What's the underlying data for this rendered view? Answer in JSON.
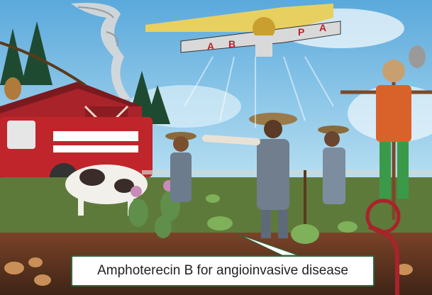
{
  "caption": {
    "text": "Amphoterecin B for angioinvasive disease"
  },
  "plane": {
    "wing_letters_left": [
      "A",
      "B"
    ],
    "wing_letters_right": [
      "P",
      "A"
    ]
  },
  "colors": {
    "sky": "#7fc3e8",
    "barn": "#b2242a",
    "tractor": "#c0252b",
    "caption_border": "#2a6b3a",
    "grass": "#5e7a3a",
    "soil": "#6b3a24"
  }
}
